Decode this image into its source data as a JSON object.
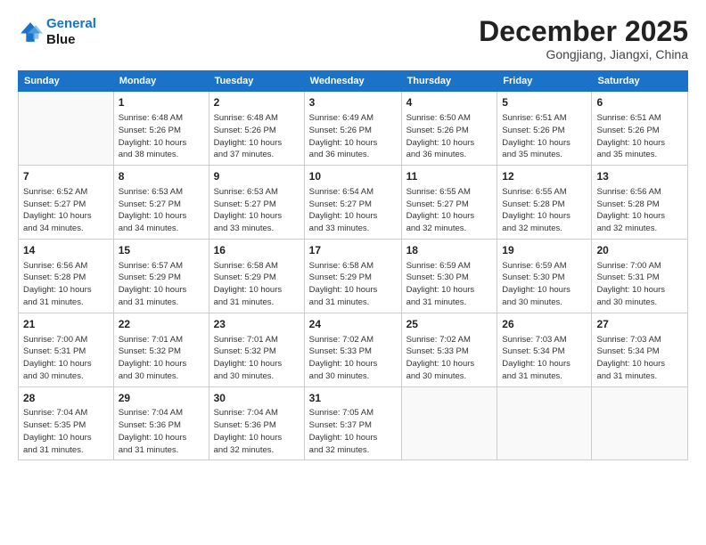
{
  "logo": {
    "line1": "General",
    "line2": "Blue"
  },
  "header": {
    "month": "December 2025",
    "location": "Gongjiang, Jiangxi, China"
  },
  "weekdays": [
    "Sunday",
    "Monday",
    "Tuesday",
    "Wednesday",
    "Thursday",
    "Friday",
    "Saturday"
  ],
  "weeks": [
    [
      {
        "day": "",
        "info": ""
      },
      {
        "day": "1",
        "info": "Sunrise: 6:48 AM\nSunset: 5:26 PM\nDaylight: 10 hours\nand 38 minutes."
      },
      {
        "day": "2",
        "info": "Sunrise: 6:48 AM\nSunset: 5:26 PM\nDaylight: 10 hours\nand 37 minutes."
      },
      {
        "day": "3",
        "info": "Sunrise: 6:49 AM\nSunset: 5:26 PM\nDaylight: 10 hours\nand 36 minutes."
      },
      {
        "day": "4",
        "info": "Sunrise: 6:50 AM\nSunset: 5:26 PM\nDaylight: 10 hours\nand 36 minutes."
      },
      {
        "day": "5",
        "info": "Sunrise: 6:51 AM\nSunset: 5:26 PM\nDaylight: 10 hours\nand 35 minutes."
      },
      {
        "day": "6",
        "info": "Sunrise: 6:51 AM\nSunset: 5:26 PM\nDaylight: 10 hours\nand 35 minutes."
      }
    ],
    [
      {
        "day": "7",
        "info": "Sunrise: 6:52 AM\nSunset: 5:27 PM\nDaylight: 10 hours\nand 34 minutes."
      },
      {
        "day": "8",
        "info": "Sunrise: 6:53 AM\nSunset: 5:27 PM\nDaylight: 10 hours\nand 34 minutes."
      },
      {
        "day": "9",
        "info": "Sunrise: 6:53 AM\nSunset: 5:27 PM\nDaylight: 10 hours\nand 33 minutes."
      },
      {
        "day": "10",
        "info": "Sunrise: 6:54 AM\nSunset: 5:27 PM\nDaylight: 10 hours\nand 33 minutes."
      },
      {
        "day": "11",
        "info": "Sunrise: 6:55 AM\nSunset: 5:27 PM\nDaylight: 10 hours\nand 32 minutes."
      },
      {
        "day": "12",
        "info": "Sunrise: 6:55 AM\nSunset: 5:28 PM\nDaylight: 10 hours\nand 32 minutes."
      },
      {
        "day": "13",
        "info": "Sunrise: 6:56 AM\nSunset: 5:28 PM\nDaylight: 10 hours\nand 32 minutes."
      }
    ],
    [
      {
        "day": "14",
        "info": "Sunrise: 6:56 AM\nSunset: 5:28 PM\nDaylight: 10 hours\nand 31 minutes."
      },
      {
        "day": "15",
        "info": "Sunrise: 6:57 AM\nSunset: 5:29 PM\nDaylight: 10 hours\nand 31 minutes."
      },
      {
        "day": "16",
        "info": "Sunrise: 6:58 AM\nSunset: 5:29 PM\nDaylight: 10 hours\nand 31 minutes."
      },
      {
        "day": "17",
        "info": "Sunrise: 6:58 AM\nSunset: 5:29 PM\nDaylight: 10 hours\nand 31 minutes."
      },
      {
        "day": "18",
        "info": "Sunrise: 6:59 AM\nSunset: 5:30 PM\nDaylight: 10 hours\nand 31 minutes."
      },
      {
        "day": "19",
        "info": "Sunrise: 6:59 AM\nSunset: 5:30 PM\nDaylight: 10 hours\nand 30 minutes."
      },
      {
        "day": "20",
        "info": "Sunrise: 7:00 AM\nSunset: 5:31 PM\nDaylight: 10 hours\nand 30 minutes."
      }
    ],
    [
      {
        "day": "21",
        "info": "Sunrise: 7:00 AM\nSunset: 5:31 PM\nDaylight: 10 hours\nand 30 minutes."
      },
      {
        "day": "22",
        "info": "Sunrise: 7:01 AM\nSunset: 5:32 PM\nDaylight: 10 hours\nand 30 minutes."
      },
      {
        "day": "23",
        "info": "Sunrise: 7:01 AM\nSunset: 5:32 PM\nDaylight: 10 hours\nand 30 minutes."
      },
      {
        "day": "24",
        "info": "Sunrise: 7:02 AM\nSunset: 5:33 PM\nDaylight: 10 hours\nand 30 minutes."
      },
      {
        "day": "25",
        "info": "Sunrise: 7:02 AM\nSunset: 5:33 PM\nDaylight: 10 hours\nand 30 minutes."
      },
      {
        "day": "26",
        "info": "Sunrise: 7:03 AM\nSunset: 5:34 PM\nDaylight: 10 hours\nand 31 minutes."
      },
      {
        "day": "27",
        "info": "Sunrise: 7:03 AM\nSunset: 5:34 PM\nDaylight: 10 hours\nand 31 minutes."
      }
    ],
    [
      {
        "day": "28",
        "info": "Sunrise: 7:04 AM\nSunset: 5:35 PM\nDaylight: 10 hours\nand 31 minutes."
      },
      {
        "day": "29",
        "info": "Sunrise: 7:04 AM\nSunset: 5:36 PM\nDaylight: 10 hours\nand 31 minutes."
      },
      {
        "day": "30",
        "info": "Sunrise: 7:04 AM\nSunset: 5:36 PM\nDaylight: 10 hours\nand 32 minutes."
      },
      {
        "day": "31",
        "info": "Sunrise: 7:05 AM\nSunset: 5:37 PM\nDaylight: 10 hours\nand 32 minutes."
      },
      {
        "day": "",
        "info": ""
      },
      {
        "day": "",
        "info": ""
      },
      {
        "day": "",
        "info": ""
      }
    ]
  ]
}
